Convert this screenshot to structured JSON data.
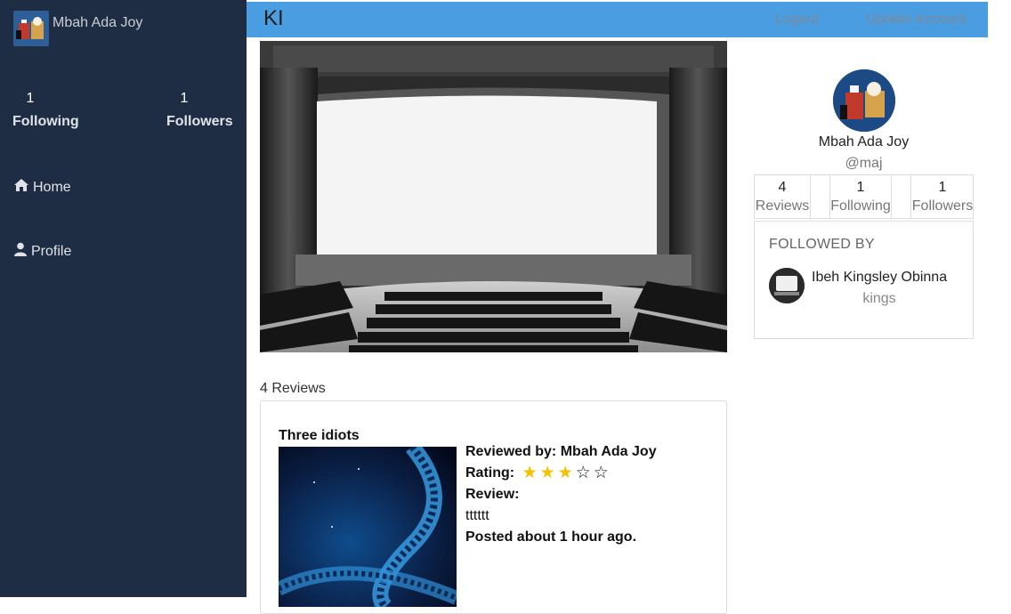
{
  "sidebar": {
    "user_name": "Mbah Ada Joy",
    "following_count": "1",
    "following_label": "Following",
    "followers_count": "1",
    "followers_label": "Followers",
    "nav": [
      {
        "label": "Home",
        "icon": "home-icon"
      },
      {
        "label": "Profile",
        "icon": "user-icon"
      }
    ]
  },
  "topbar": {
    "brand": "KI",
    "logout_label": "Logout",
    "update_label": "Update Account"
  },
  "main": {
    "reviews_count_label": "4 Reviews",
    "review": {
      "title": "Three idiots",
      "reviewed_by_label": "Reviewed by:",
      "reviewer": "Mbah Ada Joy",
      "rating_label": "Rating:",
      "rating": 3,
      "rating_max": 5,
      "review_label": "Review:",
      "review_text": "tttttt",
      "posted": "Posted about 1 hour ago."
    }
  },
  "profile": {
    "name": "Mbah Ada Joy",
    "handle": "@maj",
    "stats": [
      {
        "value": "4",
        "label": "Reviews"
      },
      {
        "value": "1",
        "label": "Following"
      },
      {
        "value": "1",
        "label": "Followers"
      }
    ],
    "followed_by_title": "FOLLOWED BY",
    "follower": {
      "name": "Ibeh Kingsley Obinna",
      "handle": "kings"
    }
  },
  "colors": {
    "sidebar_bg": "#1f2d44",
    "topbar_bg": "#4a9de0",
    "star_on": "#f2c200"
  }
}
